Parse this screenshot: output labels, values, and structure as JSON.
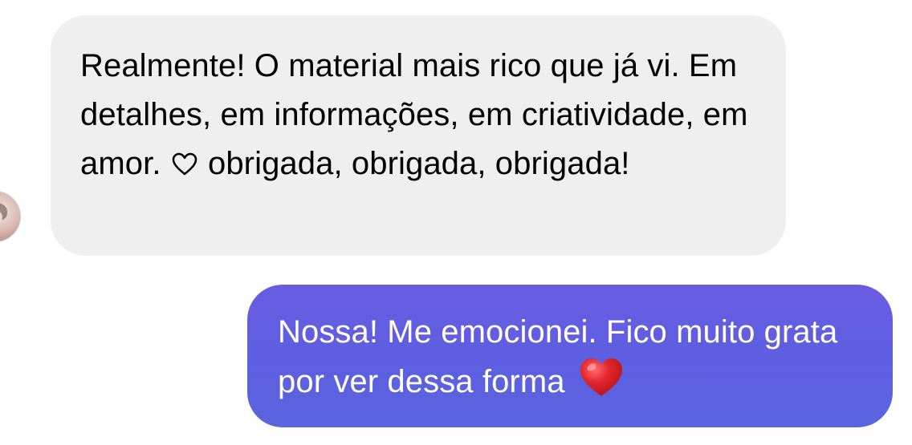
{
  "conversation": {
    "received": {
      "text_before_icon": "Realmente! O material mais rico que já vi. Em detalhes, em informações, em criatividade, em amor.",
      "icon": "white-heart-outline-icon",
      "text_after_icon": "obrigada, obrigada, obrigada!"
    },
    "sent": {
      "text": "Nossa! Me emocionei. Fico muito grata por ver dessa forma",
      "icon": "red-heart-emoji-icon"
    }
  },
  "colors": {
    "received_bubble": "#efefef",
    "sent_bubble_top": "#6a5ce2",
    "sent_bubble_bottom": "#5a65dd",
    "heart_red": "#e3262c"
  }
}
